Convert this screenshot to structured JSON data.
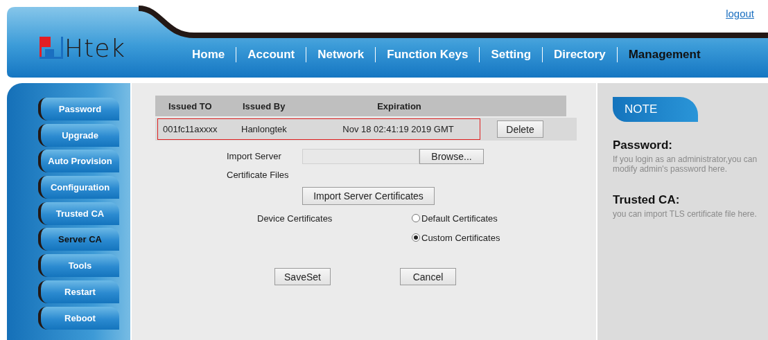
{
  "logout": "logout",
  "logo": "Htek",
  "nav": [
    {
      "label": "Home",
      "selected": false
    },
    {
      "label": "Account",
      "selected": false
    },
    {
      "label": "Network",
      "selected": false
    },
    {
      "label": "Function Keys",
      "selected": false
    },
    {
      "label": "Setting",
      "selected": false
    },
    {
      "label": "Directory",
      "selected": false
    },
    {
      "label": "Management",
      "selected": true
    }
  ],
  "sidebar": [
    {
      "label": "Password",
      "selected": false
    },
    {
      "label": "Upgrade",
      "selected": false
    },
    {
      "label": "Auto Provision",
      "selected": false
    },
    {
      "label": "Configuration",
      "selected": false
    },
    {
      "label": "Trusted CA",
      "selected": false
    },
    {
      "label": "Server CA",
      "selected": true
    },
    {
      "label": "Tools",
      "selected": false
    },
    {
      "label": "Restart",
      "selected": false
    },
    {
      "label": "Reboot",
      "selected": false
    }
  ],
  "certificates": {
    "columns": [
      "Issued TO",
      "Issued By",
      "Expiration"
    ],
    "rows": [
      {
        "issued_to": "001fc11axxxx",
        "issued_by": "Hanlongtek",
        "expiration": "Nov 18 02:41:19 2019 GMT",
        "delete": "Delete",
        "highlighted": true
      }
    ]
  },
  "import": {
    "label": "Import Server Certificate Files",
    "browse": "Browse...",
    "button": "Import Server Certificates"
  },
  "device_certificates": {
    "label": "Device Certificates",
    "options": [
      {
        "label": "Default Certificates",
        "selected": false
      },
      {
        "label": "Custom Certificates",
        "selected": true
      }
    ]
  },
  "buttons": [
    "SaveSet",
    "Cancel"
  ],
  "note": {
    "title": "NOTE",
    "items": [
      {
        "heading": "Password:",
        "text": "If you login as an administrator,you can modify admin's password here."
      },
      {
        "heading": "Trusted CA:",
        "text": "you can import TLS certificate file here."
      }
    ]
  }
}
